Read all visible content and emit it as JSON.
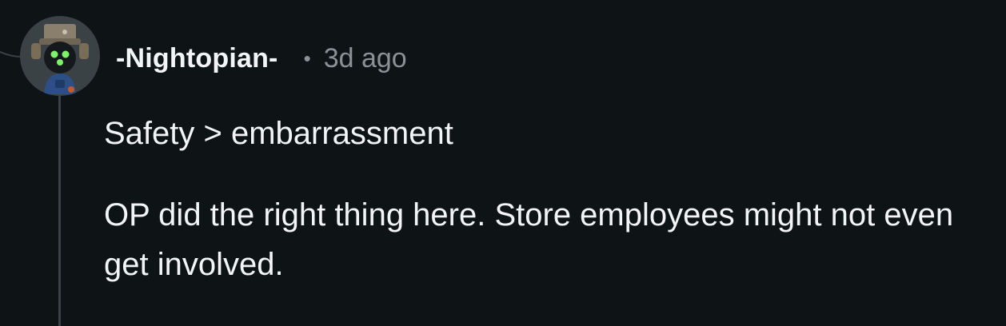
{
  "comment": {
    "avatar_icon": "robot-avatar-icon",
    "username": "-Nightopian-",
    "separator": "•",
    "timestamp": "3d ago",
    "paragraphs": [
      "Safety > embarrassment",
      "OP did the right thing here. Store employees might not even get involved."
    ]
  },
  "colors": {
    "background": "#0e1416",
    "text": "#f2f4f5",
    "meta": "#8a9296",
    "thread_line": "#3a4044",
    "avatar_eyes": "#7cf36a"
  }
}
